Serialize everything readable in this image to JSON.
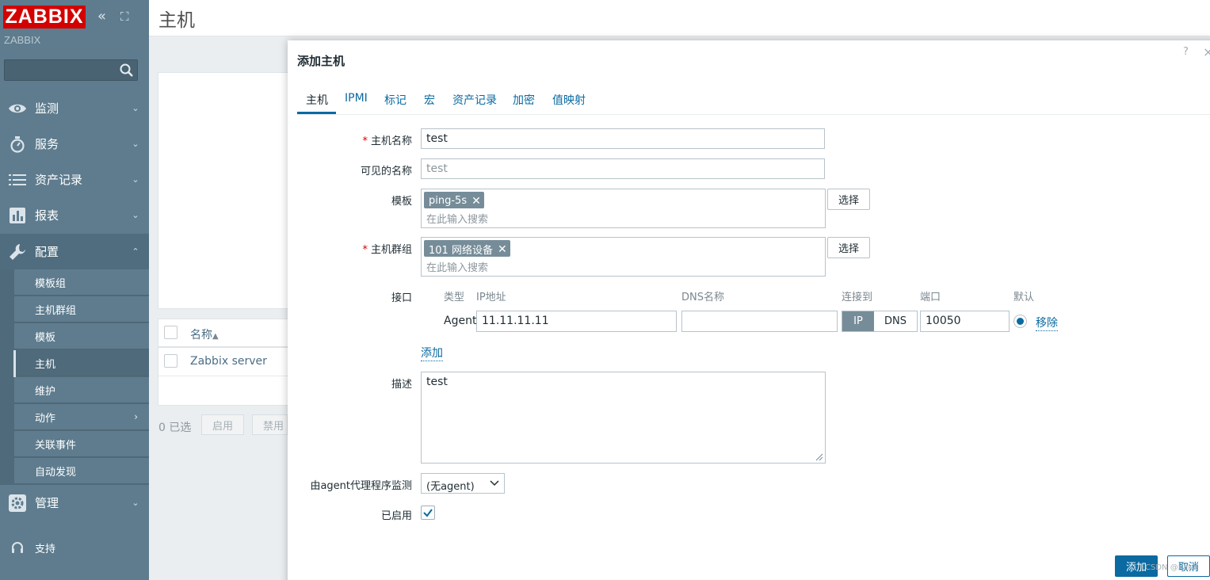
{
  "sidebar": {
    "logo": "ZABBIX",
    "server_name": "ZABBIX",
    "menu": [
      {
        "label": "监测",
        "icon": "eye-icon"
      },
      {
        "label": "服务",
        "icon": "stopwatch-icon"
      },
      {
        "label": "资产记录",
        "icon": "list-icon"
      },
      {
        "label": "报表",
        "icon": "bar-chart-icon"
      },
      {
        "label": "配置",
        "icon": "wrench-icon"
      },
      {
        "label": "管理",
        "icon": "gear-icon"
      },
      {
        "label": "支持",
        "icon": "headset-icon"
      }
    ],
    "submenu": [
      "模板组",
      "主机群组",
      "模板",
      "主机",
      "维护",
      "动作",
      "关联事件",
      "自动发现"
    ]
  },
  "page": {
    "title": "主机",
    "list": {
      "name_header": "名称",
      "sort_arrow": "▲",
      "rows": [
        "Zabbix server"
      ],
      "selected": "0 已选",
      "buttons": [
        "启用",
        "禁用"
      ]
    }
  },
  "dialog": {
    "title": "添加主机",
    "help": "?",
    "close": "×",
    "tabs": [
      "主机",
      "IPMI",
      "标记",
      "宏",
      "资产记录",
      "加密",
      "值映射"
    ],
    "fields": {
      "host_name_label": "主机名称",
      "host_name_value": "test",
      "visible_name_label": "可见的名称",
      "visible_name_placeholder": "test",
      "templates_label": "模板",
      "template_tag": "ping-5s",
      "templates_placeholder": "在此输入搜索",
      "groups_label": "主机群组",
      "group_tag": "101 网络设备",
      "groups_placeholder": "在此输入搜索",
      "select_button": "选择",
      "interfaces_label": "接口",
      "description_label": "描述",
      "description_value": "test",
      "proxy_label": "由agent代理程序监测",
      "proxy_value": "(无agent)",
      "enabled_label": "已启用",
      "enabled": true
    },
    "interface": {
      "headers": {
        "type": "类型",
        "ip": "IP地址",
        "dns": "DNS名称",
        "connect": "连接到",
        "port": "端口",
        "default": "默认"
      },
      "type": "Agent",
      "ip": "11.11.11.11",
      "dns": "",
      "connect_ip": "IP",
      "connect_dns": "DNS",
      "port": "10050",
      "remove": "移除",
      "add": "添加"
    },
    "buttons": {
      "add": "添加",
      "cancel": "取消"
    },
    "watermark": "CSDN @Kaka"
  },
  "colors": {
    "sidebar": "#5e7c8e",
    "accent": "#0a6aa1",
    "logo": "#d40000",
    "required": "#d40000",
    "tag": "#768d99"
  }
}
